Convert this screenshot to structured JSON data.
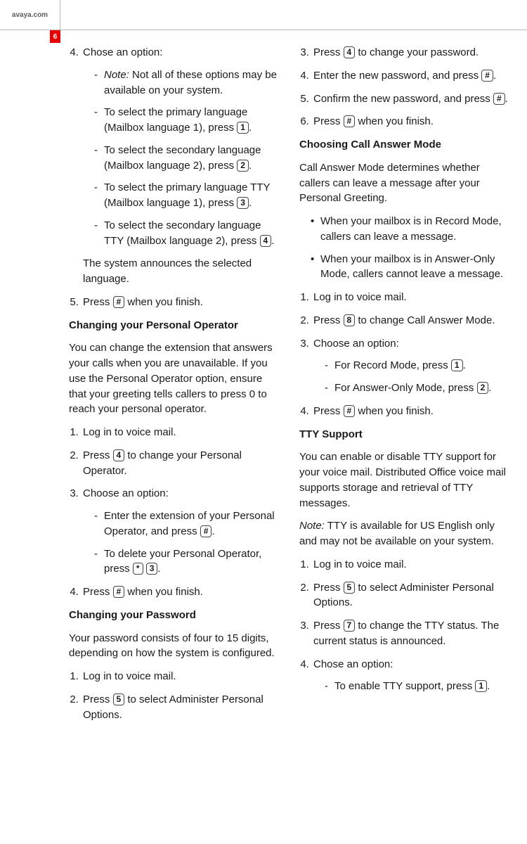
{
  "header": {
    "site": "avaya.com",
    "pagenum": "6"
  },
  "k": {
    "1": "1",
    "2": "2",
    "3": "3",
    "4": "4",
    "5": "5",
    "7": "7",
    "8": "8",
    "hash": "#",
    "star": "*"
  },
  "left": {
    "s4": {
      "lead": "Chose an option:",
      "note_pre": "Note:",
      "note_body": " Not all of these options may be available on your system.",
      "opt1a": "To select the primary language (Mailbox language 1), press ",
      "opt1b": ".",
      "opt2a": "To select the secondary language (Mailbox language 2), press ",
      "opt2b": ".",
      "opt3a": "To select the primary language TTY (Mailbox language 1), press ",
      "opt3b": ".",
      "opt4a": "To select the secondary language TTY (Mailbox language 2), press ",
      "opt4b": ".",
      "after": "The system announces the selected language."
    },
    "s5a": "Press ",
    "s5b": " when you finish.",
    "h1": "Changing your Personal Operator",
    "p1": "You can change the extension that answers your calls when you are unavailable. If you use the Personal Operator option, ensure that your greeting tells callers to press 0 to reach your personal operator.",
    "po1": "Log in to voice mail.",
    "po2a": "Press ",
    "po2b": " to change your Personal Operator.",
    "po3": "Choose an option:",
    "po3aa": "Enter the extension of your Personal Operator, and press ",
    "po3ab": ".",
    "po3ba": "To delete your Personal Operator, press ",
    "po3bb": " ",
    "po3bc": ".",
    "po4a": "Press ",
    "po4b": " when you finish.",
    "h2": "Changing your Password",
    "p2": "Your password consists of four to 15 digits, depending on how the system is configured.",
    "pw1": "Log in to voice mail.",
    "pw2a": "Press ",
    "pw2b": " to select Administer Personal Options."
  },
  "right": {
    "pw3a": "Press ",
    "pw3b": " to change your password.",
    "pw4a": "Enter the new password, and press ",
    "pw4b": ".",
    "pw5a": "Confirm the new password, and press ",
    "pw5b": ".",
    "pw6a": "Press ",
    "pw6b": " when you finish.",
    "h3": "Choosing Call Answer Mode",
    "p3": "Call Answer Mode determines whether callers can leave a message after your Personal Greeting.",
    "b1": "When your mailbox is in Record Mode, callers can leave a message.",
    "b2": "When your mailbox is in Answer-Only Mode, callers cannot leave a message.",
    "ca1": "Log in to voice mail.",
    "ca2a": "Press ",
    "ca2b": " to change Call Answer Mode.",
    "ca3": "Choose an option:",
    "ca3aa": "For Record Mode, press ",
    "ca3ab": ".",
    "ca3ba": "For Answer-Only Mode, press ",
    "ca3bb": ".",
    "ca4a": "Press ",
    "ca4b": " when you finish.",
    "h4": "TTY Support",
    "p4": "You can enable or disable TTY support for your voice mail. Distributed Office voice mail supports storage and retrieval of TTY messages.",
    "note2_pre": "Note:",
    "note2_body": " TTY is available for US English only and may not be available on your system.",
    "tt1": "Log in to voice mail.",
    "tt2a": "Press ",
    "tt2b": " to select Administer Personal Options.",
    "tt3a": "Press ",
    "tt3b": " to change the TTY status. The current status is announced.",
    "tt4": "Chose an option:",
    "tt4aa": "To enable TTY support, press ",
    "tt4ab": "."
  }
}
